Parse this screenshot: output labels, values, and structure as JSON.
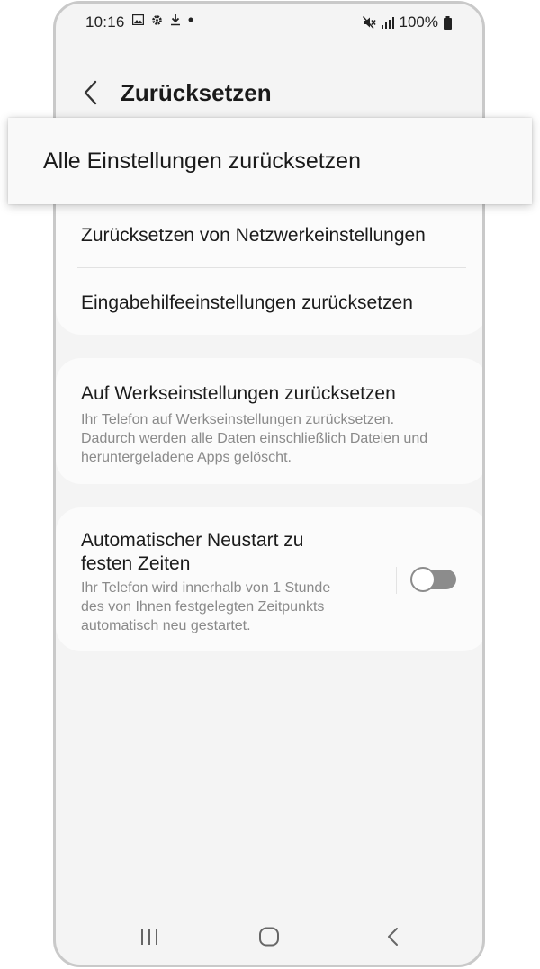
{
  "status_bar": {
    "time": "10:16",
    "battery": "100%",
    "icons_left": [
      "gallery-icon",
      "gear-icon",
      "download-icon",
      "dot-icon"
    ],
    "icons_right": [
      "mute-icon",
      "signal-icon",
      "battery-icon"
    ]
  },
  "header": {
    "title": "Zurücksetzen",
    "back_icon": "chevron-left-icon"
  },
  "highlight": {
    "label": "Alle Einstellungen zurücksetzen"
  },
  "card1": {
    "items": [
      {
        "title": "Zurücksetzen von Netzwerkeinstellungen"
      },
      {
        "title": "Eingabehilfeeinstellungen zurücksetzen"
      }
    ]
  },
  "card2": {
    "title": "Auf Werkseinstellungen zurücksetzen",
    "subtitle_lines": [
      "Ihr Telefon auf Werkseinstellungen zurücksetzen.",
      "Dadurch werden alle Daten einschließlich Dateien und",
      "heruntergeladene Apps gelöscht."
    ]
  },
  "card3": {
    "title_lines": [
      "Automatischer Neustart zu",
      "festen Zeiten"
    ],
    "subtitle_lines": [
      "Ihr Telefon wird innerhalb von 1 Stunde",
      "des von Ihnen festgelegten Zeitpunkts",
      "automatisch neu gestartet."
    ],
    "toggle_on": false
  },
  "navbar": {
    "icons": [
      "recent-apps-icon",
      "home-icon",
      "back-icon"
    ]
  }
}
